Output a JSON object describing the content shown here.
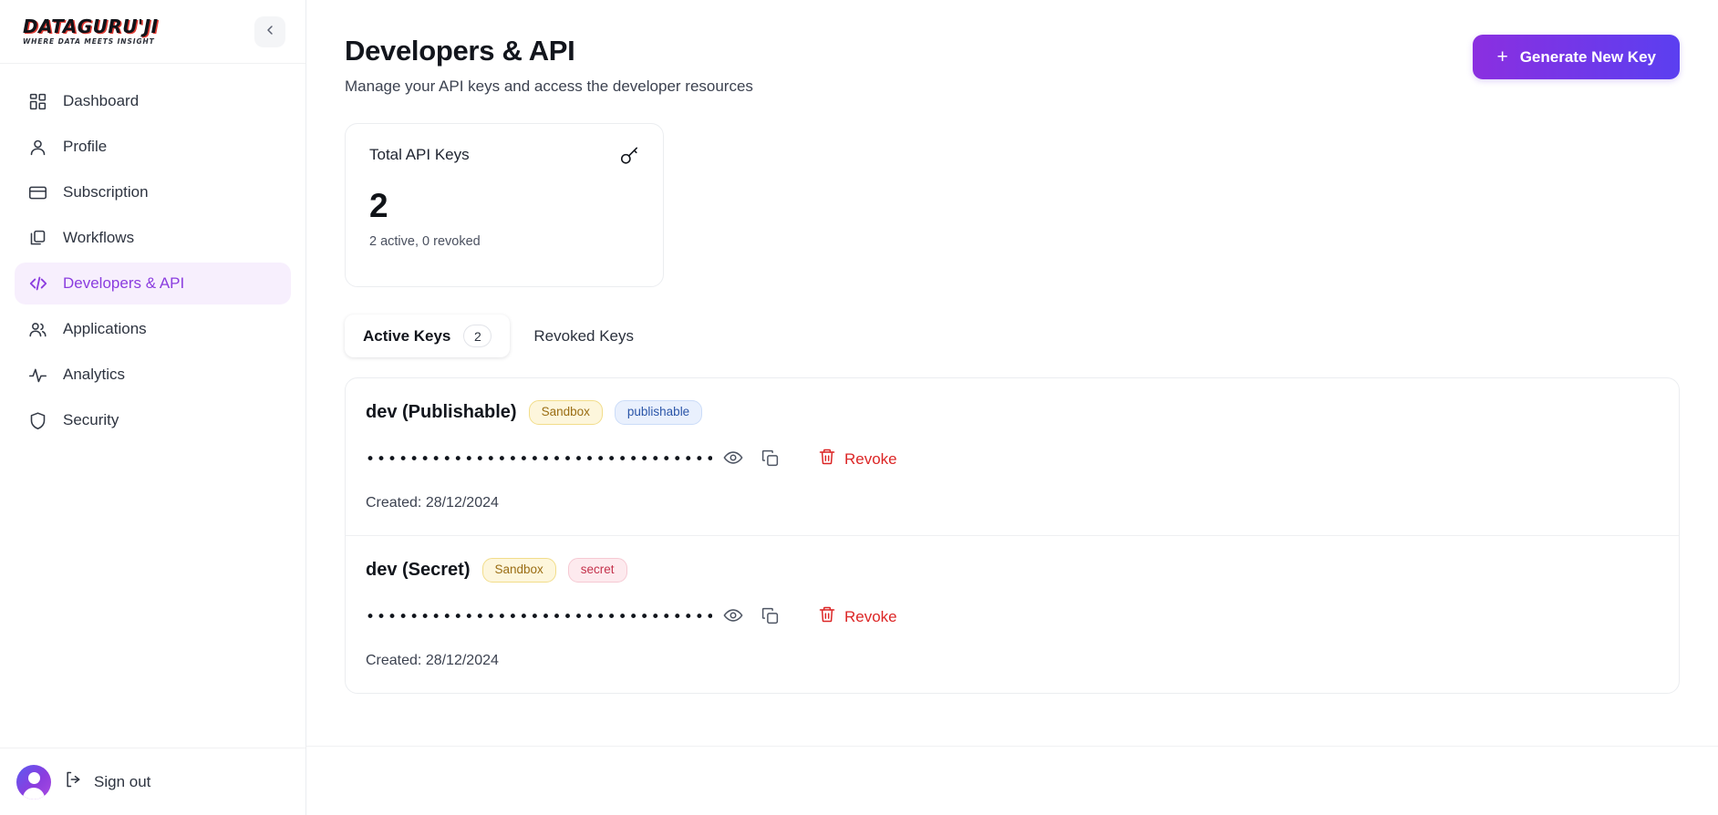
{
  "sidebar": {
    "logo": {
      "main": "DATAGURU'JI",
      "sub": "WHERE DATA MEETS INSIGHT"
    },
    "collapse_label": "<",
    "items": [
      {
        "label": "Dashboard",
        "icon": "dashboard-grid-icon",
        "active": false
      },
      {
        "label": "Profile",
        "icon": "user-icon",
        "active": false
      },
      {
        "label": "Subscription",
        "icon": "credit-card-icon",
        "active": false
      },
      {
        "label": "Workflows",
        "icon": "copy-stack-icon",
        "active": false
      },
      {
        "label": "Developers & API",
        "icon": "code-brackets-icon",
        "active": true
      },
      {
        "label": "Applications",
        "icon": "users-group-icon",
        "active": false
      },
      {
        "label": "Analytics",
        "icon": "activity-pulse-icon",
        "active": false
      },
      {
        "label": "Security",
        "icon": "shield-icon",
        "active": false
      }
    ],
    "footer": {
      "signout_label": "Sign out",
      "signout_icon": "logout-icon",
      "avatar_icon": "avatar-person-icon"
    }
  },
  "header": {
    "title": "Developers & API",
    "subtitle": "Manage your API keys and access the developer resources",
    "generate_button": {
      "label": "Generate New Key",
      "icon": "plus-icon"
    }
  },
  "stat_card": {
    "label": "Total API Keys",
    "icon": "key-icon",
    "value": "2",
    "meta": "2 active, 0 revoked"
  },
  "tabs": [
    {
      "label": "Active Keys",
      "count": "2",
      "active": true
    },
    {
      "label": "Revoked Keys",
      "count": null,
      "active": false
    }
  ],
  "keys": [
    {
      "name": "dev (Publishable)",
      "badges": [
        {
          "text": "Sandbox",
          "kind": "sandbox"
        },
        {
          "text": "publishable",
          "kind": "publishable"
        }
      ],
      "masked_value": "••••••••••••••••••••••••••••••••••••",
      "actions": {
        "reveal_icon": "eye-icon",
        "copy_icon": "copy-icon",
        "revoke_label": "Revoke",
        "revoke_icon": "trash-icon"
      },
      "created": "Created: 28/12/2024"
    },
    {
      "name": "dev (Secret)",
      "badges": [
        {
          "text": "Sandbox",
          "kind": "sandbox"
        },
        {
          "text": "secret",
          "kind": "secret"
        }
      ],
      "masked_value": "••••••••••••••••••••••••••••••••••••",
      "actions": {
        "reveal_icon": "eye-icon",
        "copy_icon": "copy-icon",
        "revoke_label": "Revoke",
        "revoke_icon": "trash-icon"
      },
      "created": "Created: 28/12/2024"
    }
  ],
  "colors": {
    "accent_purple": "#8b3ddf",
    "accent_blue": "#5b3ff0",
    "danger_red": "#dc2626",
    "badge_sandbox": "#9a6d13",
    "badge_publishable": "#2b55a8",
    "badge_secret": "#c4324c"
  }
}
